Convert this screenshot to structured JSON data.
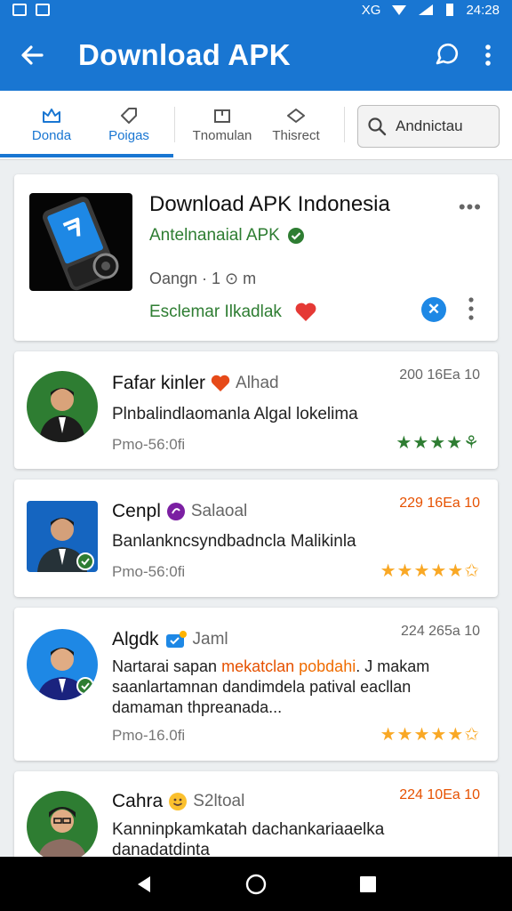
{
  "status": {
    "time": "24:28",
    "network": "XG"
  },
  "appbar": {
    "title": "Download APK"
  },
  "tabs": [
    {
      "label": "Donda"
    },
    {
      "label": "Poigas"
    },
    {
      "label": "Tnomulan"
    },
    {
      "label": "Thisrect"
    }
  ],
  "search": {
    "label": "Andnictau"
  },
  "app": {
    "title": "Download APK Indonesia",
    "subtitle": "Antelnanaial APK",
    "meta": "Oangn · 1 ⊙ m",
    "action": "Esclemar Ilkadlak"
  },
  "reviews": [
    {
      "name": "Fafar kinler",
      "sub": "Alhad",
      "date": "200 16Ea 10",
      "text": "Plnbalindlaomanla Algal lokelima",
      "meta": "Pmo-56:0fi",
      "stars": "★★★★⚘",
      "stars_color": "#2e7d32"
    },
    {
      "name": "Cenpl",
      "sub": "Salaoal",
      "date": "229 16Ea 10",
      "text": "Banlankncsyndbadncla Malikinla",
      "meta": "Pmo-56:0fi",
      "stars": "★★★★★✩",
      "stars_color": "#f9a825"
    },
    {
      "name": "Algdk",
      "sub": "Jaml",
      "date": "224 265a 10",
      "text_a": "Nartarai sapan ",
      "text_b": "mekatclan",
      "text_c": " ",
      "text_d": "pobdahi",
      "text_e": ". J makam",
      "text_line2": "saanlartamnan dandimdela patival eacllan",
      "text_line3": "damaman thpreanada...",
      "meta": "Pmo-16.0fi",
      "stars": "★★★★★✩",
      "stars_color": "#f9a825"
    },
    {
      "name": "Cahra",
      "sub": "S2ltoal",
      "date": "224 10Ea 10",
      "text": "Kanninpkamkatah dachankariaaelka",
      "text_line2": "danadatdinta",
      "stars_color": "#f9a825"
    }
  ],
  "colors": {
    "primary": "#1976d2",
    "green": "#2e7d32",
    "star": "#f9a825"
  }
}
